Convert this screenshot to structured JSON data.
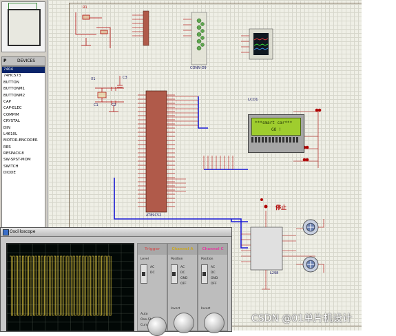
{
  "sidebar": {
    "devices_header": {
      "p_label": "P",
      "title": "DEVICES"
    },
    "devices": [
      "7404",
      "74HC573",
      "BUTTON",
      "BUTTONM1",
      "BUTTONM2",
      "CAP",
      "CAP-ELEC",
      "COMPIM",
      "CRYSTAL",
      "DIN",
      "L4610L",
      "MOTOR-ENCODER",
      "RES",
      "RESPACK-8",
      "SW-SPST-MOM",
      "SWITCH",
      "DIODE"
    ],
    "selected_index": 0
  },
  "schematic": {
    "lcd_ref": "LCD1",
    "lcd_lines": [
      "***smart car***",
      "GO !"
    ],
    "mcu_part": "AT89C52",
    "driver_part": "L298",
    "connector_part": "CONN-D9",
    "stop_label": "停止",
    "crystal_ref": "X1",
    "caps": [
      "C1",
      "C2",
      "C3"
    ]
  },
  "oscilloscope": {
    "title": "Oscilloscope",
    "channels": [
      {
        "name": "Trigger",
        "color": "#c86464"
      },
      {
        "name": "Channel A",
        "color": "#d8c23a"
      },
      {
        "name": "Channel C",
        "color": "#e040a0"
      }
    ],
    "trigger_labels": [
      "Level",
      "AC",
      "DC",
      "Auto",
      "One-Shot",
      "Cursors"
    ],
    "channel_labels": [
      "Position",
      "AC",
      "DC",
      "GND",
      "OFF",
      "Invert"
    ],
    "trace_color": "#c8b23a"
  },
  "watermark": "CSDN @01单片机设计"
}
